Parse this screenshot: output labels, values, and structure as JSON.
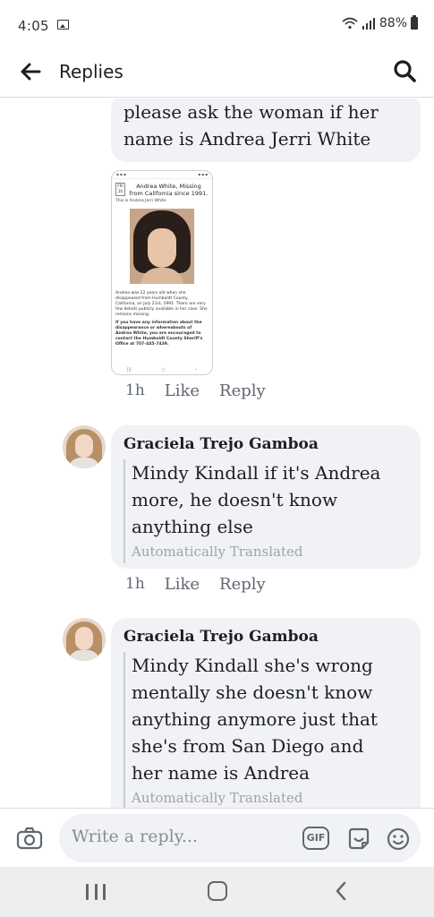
{
  "status_bar": {
    "time": "4:05",
    "battery": "88%"
  },
  "header": {
    "title": "Replies"
  },
  "thread": {
    "first_message": {
      "lines": [
        "please ask the woman if her",
        "name is Andrea Jerri White"
      ]
    },
    "attachment": {
      "date_top": "FRI",
      "date_num": "20",
      "title": "Andrea White, Missing from California since 1991.",
      "subtitle": "This is Andrea Jerri White",
      "body": "Andrea was 22 years old when she disappeared from Humboldt County, California, on July 21st, 1991. There are very few details publicly available in her case. She remains missing.",
      "body_bold": "If you have any information about the disappearance or whereabouts of Andrea White, you are encouraged to contact the Humboldt County Sheriff's Office at 707-445-7439."
    },
    "meta_1": {
      "time": "1h",
      "like": "Like",
      "reply": "Reply"
    },
    "comment_1": {
      "author": "Graciela Trejo Gamboa",
      "lines": [
        "Mindy Kindall if it's Andrea",
        "more, he doesn't know",
        "anything else"
      ],
      "translated": "Automatically Translated"
    },
    "meta_2": {
      "time": "1h",
      "like": "Like",
      "reply": "Reply"
    },
    "comment_2": {
      "author": "Graciela Trejo Gamboa",
      "lines": [
        "Mindy Kindall she's wrong",
        "mentally she doesn't know",
        "anything anymore just that",
        "she's from San Diego and",
        "her name is Andrea"
      ],
      "translated": "Automatically Translated"
    }
  },
  "compose": {
    "placeholder": "Write a reply...",
    "gif_label": "GIF"
  },
  "icons": {
    "back": "arrow-left-icon",
    "search": "search-icon",
    "camera": "camera-icon",
    "sticker": "sticker-icon",
    "emoji": "emoji-icon"
  }
}
